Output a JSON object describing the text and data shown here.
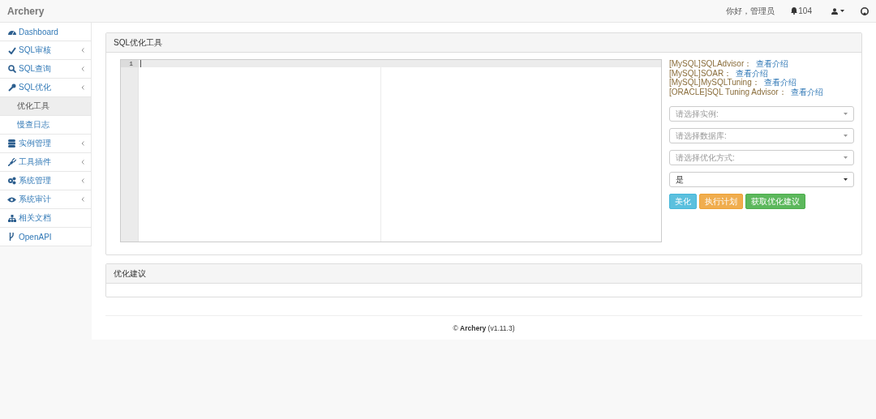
{
  "navbar": {
    "brand": "Archery",
    "greeting": "你好，管理员",
    "notification_count": "104"
  },
  "sidebar": {
    "items": [
      {
        "label": "Dashboard",
        "kind": "link",
        "selected": false
      },
      {
        "label": "SQL审核",
        "kind": "group",
        "selected": false
      },
      {
        "label": "SQL查询",
        "kind": "group",
        "selected": false
      },
      {
        "label": "SQL优化",
        "kind": "group",
        "selected": false,
        "children": [
          {
            "label": "优化工具",
            "selected": true
          },
          {
            "label": "慢查日志",
            "selected": false
          }
        ]
      },
      {
        "label": "实例管理",
        "kind": "group",
        "selected": false
      },
      {
        "label": "工具插件",
        "kind": "group",
        "selected": false
      },
      {
        "label": "系统管理",
        "kind": "group",
        "selected": false
      },
      {
        "label": "系统审计",
        "kind": "group",
        "selected": false
      },
      {
        "label": "相关文档",
        "kind": "link",
        "selected": false
      },
      {
        "label": "OpenAPI",
        "kind": "link",
        "selected": false
      }
    ]
  },
  "tool_panel": {
    "title": "SQL优化工具",
    "editor": {
      "line_numbers": [
        "1"
      ]
    },
    "tools": [
      {
        "name": "[MySQL]SQLAdvisor：",
        "link": "查看介绍"
      },
      {
        "name": "[MySQL]SOAR：",
        "link": "查看介绍"
      },
      {
        "name": "[MySQL]MySQLTuning：",
        "link": "查看介绍"
      },
      {
        "name": "[ORACLE]SQL Tuning Advisor：",
        "link": "查看介绍"
      }
    ],
    "selects": [
      {
        "placeholder": "请选择实例:"
      },
      {
        "placeholder": "请选择数据库:"
      },
      {
        "placeholder": "请选择优化方式:"
      },
      {
        "value": "是"
      }
    ],
    "buttons": [
      {
        "label": "美化",
        "kind": "info"
      },
      {
        "label": "执行计划",
        "kind": "warning"
      },
      {
        "label": "获取优化建议",
        "kind": "success"
      }
    ]
  },
  "advice_panel": {
    "title": "优化建议"
  },
  "footer": {
    "text": "© **Archery** (v1.11.3)"
  }
}
